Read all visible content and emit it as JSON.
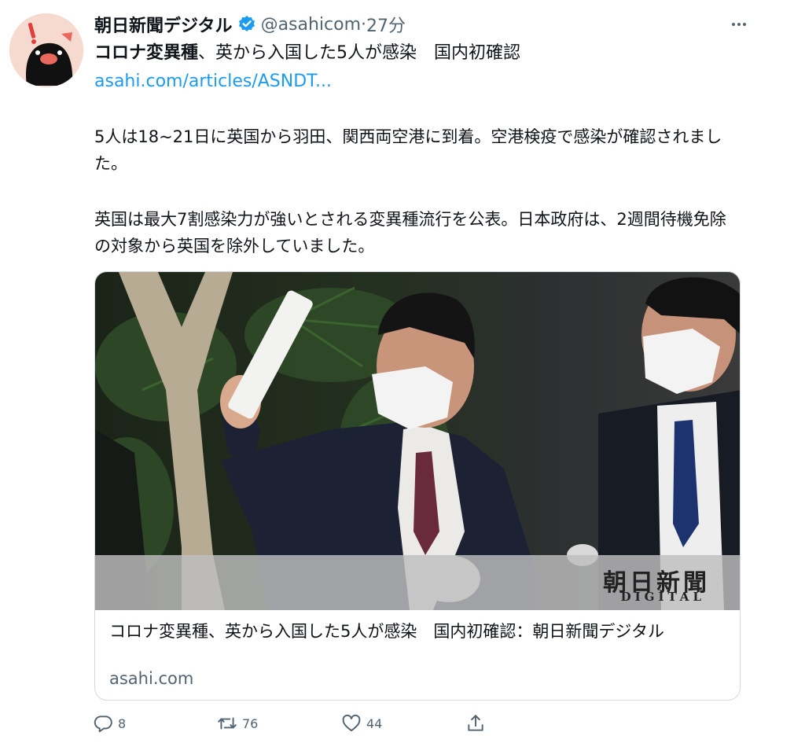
{
  "tweet": {
    "display_name": "朝日新聞デジタル",
    "handle": "@asahicom",
    "separator": "·",
    "time": "27分",
    "headline_bold": "コロナ変異種",
    "headline_rest": "、英から入国した5人が感染　国内初確認",
    "link": "asahi.com/articles/ASNDT...",
    "paragraphs": [
      "5人は18~21日に英国から羽田、関西両空港に到着。空港検疫で感染が確認されました。",
      "英国は最大7割感染力が強いとされる変異種流行を公表。日本政府は、2週間待機免除の対象から英国を除外していました。"
    ]
  },
  "card": {
    "logo_main": "朝日新聞",
    "logo_sub": "DIGITAL",
    "title": "コロナ変異種、英から入国した5人が感染　国内初確認：朝日新聞デジタル",
    "domain": "asahi.com"
  },
  "actions": {
    "reply_count": "8",
    "retweet_count": "76",
    "like_count": "44"
  },
  "colors": {
    "link": "#1d9bf0",
    "verified": "#1d9bf0",
    "secondary_text": "#536471"
  },
  "icons": [
    "avatar-mascot",
    "verified-badge-icon",
    "more-icon",
    "reply-icon",
    "retweet-icon",
    "like-icon",
    "share-icon"
  ]
}
